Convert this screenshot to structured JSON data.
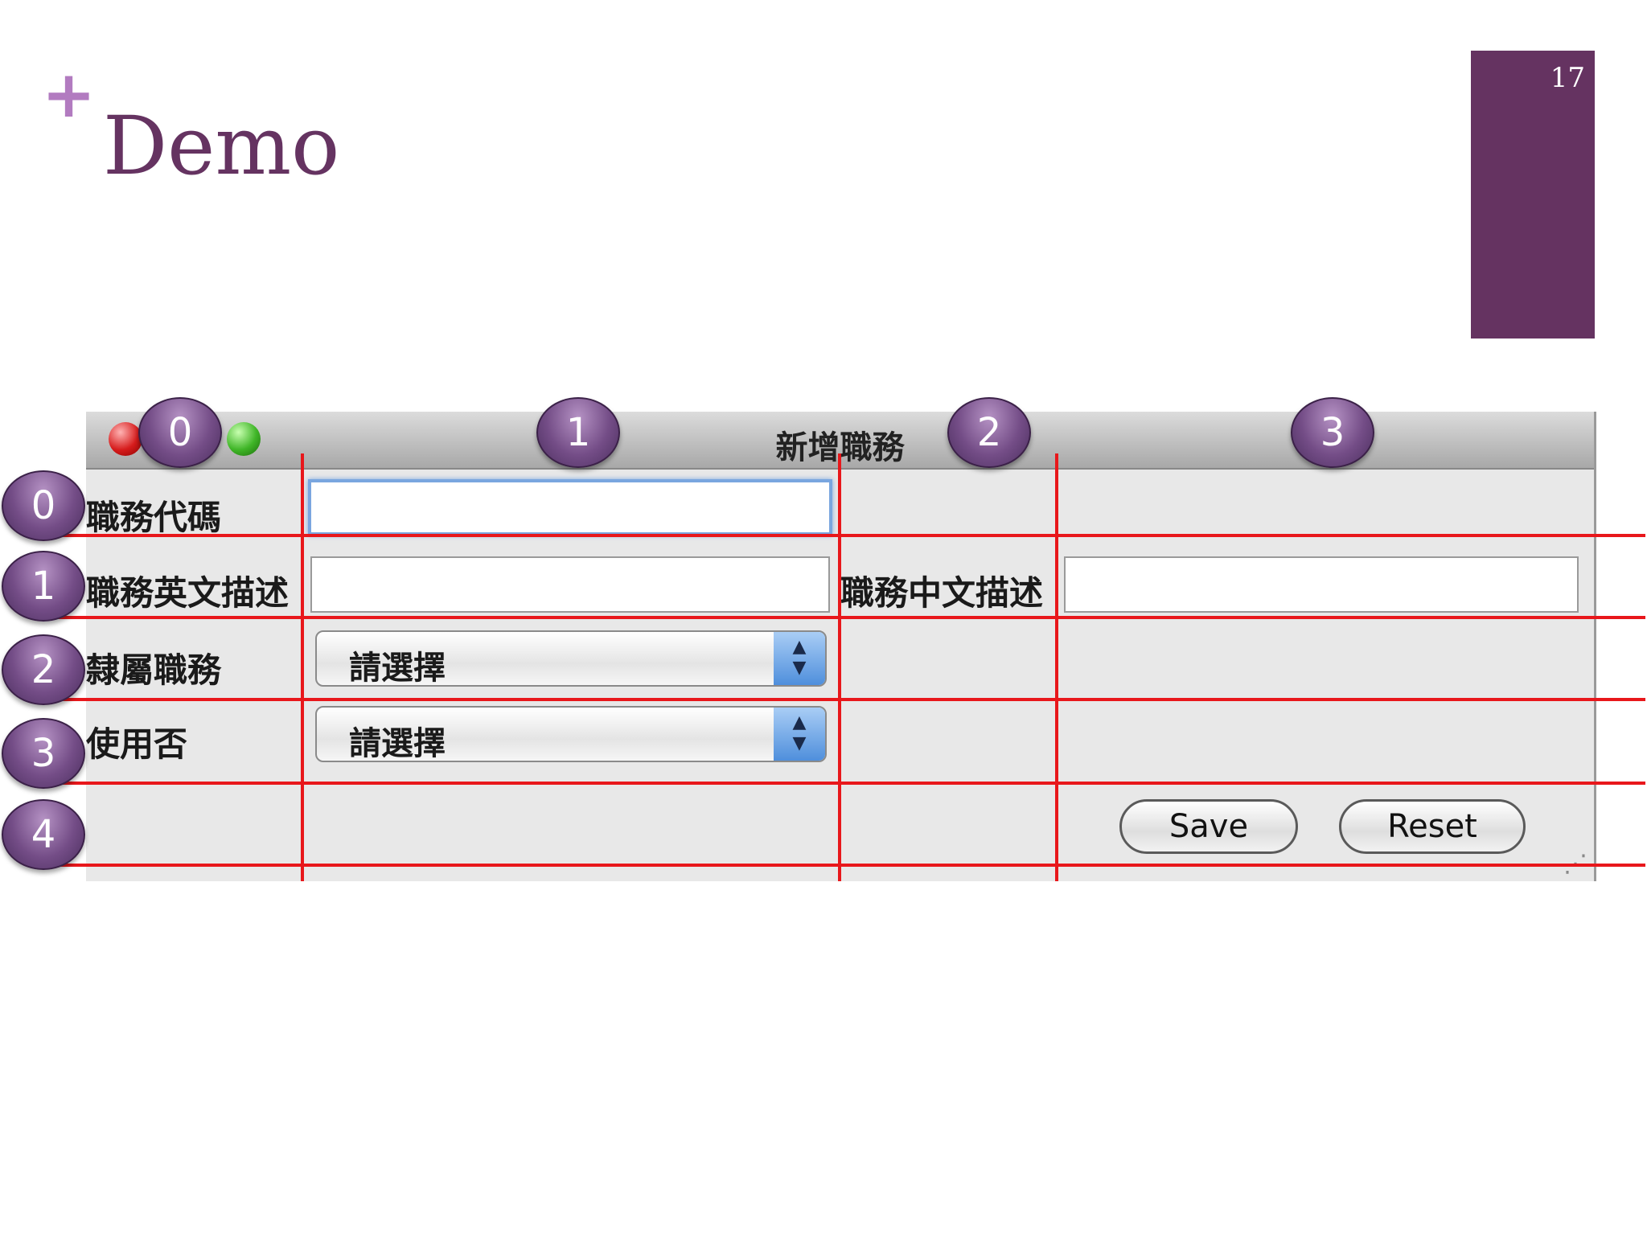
{
  "slide": {
    "title": "Demo",
    "page_number": "17",
    "plus_glyph": "+"
  },
  "window": {
    "title": "新增職務"
  },
  "form": {
    "job_code_label": "職務代碼",
    "job_code_value": "",
    "job_desc_en_label": "職務英文描述",
    "job_desc_en_value": "",
    "job_desc_zh_label": "職務中文描述",
    "job_desc_zh_value": "",
    "parent_job_label": "隸屬職務",
    "parent_job_selected": "請選擇",
    "in_use_label": "使用否",
    "in_use_selected": "請選擇",
    "save_label": "Save",
    "reset_label": "Reset"
  },
  "grid_overlay": {
    "column_markers": [
      "0",
      "1",
      "2",
      "3"
    ],
    "row_markers": [
      "0",
      "1",
      "2",
      "3",
      "4"
    ]
  },
  "colors": {
    "accent_purple": "#653361",
    "plus_purple": "#b27bc0",
    "grid_line_red": "#e8171b",
    "focus_blue": "#7aa6df"
  },
  "icons": {
    "window_controls": [
      "close-icon",
      "minimize-icon",
      "zoom-icon"
    ],
    "select_arrows": "up-down-arrows-icon",
    "resize_grip": "resize-grip-icon"
  }
}
